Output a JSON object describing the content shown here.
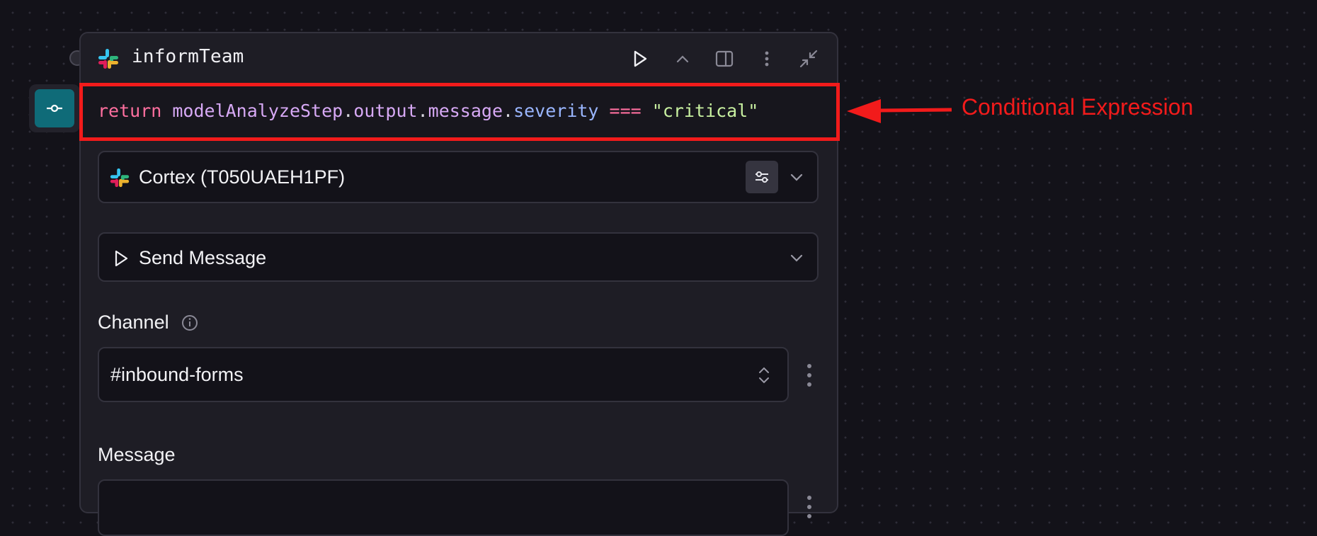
{
  "node": {
    "title": "informTeam",
    "header_actions": [
      "run-icon",
      "collapse-up-icon",
      "side-panel-icon",
      "more-vertical-icon",
      "minimize-icon"
    ]
  },
  "condition": {
    "tokens": [
      {
        "text": "return",
        "kind": "kw"
      },
      {
        "text": " ",
        "kind": "dot"
      },
      {
        "text": "modelAnalyzeStep",
        "kind": "id"
      },
      {
        "text": ".",
        "kind": "dot"
      },
      {
        "text": "output",
        "kind": "id"
      },
      {
        "text": ".",
        "kind": "dot"
      },
      {
        "text": "message",
        "kind": "id"
      },
      {
        "text": ".",
        "kind": "dot"
      },
      {
        "text": "severity",
        "kind": "prop"
      },
      {
        "text": " ",
        "kind": "dot"
      },
      {
        "text": "===",
        "kind": "op"
      },
      {
        "text": " ",
        "kind": "dot"
      },
      {
        "text": "\"critical\"",
        "kind": "str"
      }
    ]
  },
  "annotation": {
    "label": "Conditional Expression",
    "color": "#f21b1b"
  },
  "connection": {
    "label": "Cortex (T050UAEH1PF)"
  },
  "action": {
    "label": "Send Message"
  },
  "channel": {
    "label": "Channel",
    "value": "#inbound-forms"
  },
  "message": {
    "label": "Message",
    "value": ""
  },
  "colors": {
    "accent_teal": "#0f6b78",
    "background": "#131219",
    "card": "#1e1d25"
  }
}
